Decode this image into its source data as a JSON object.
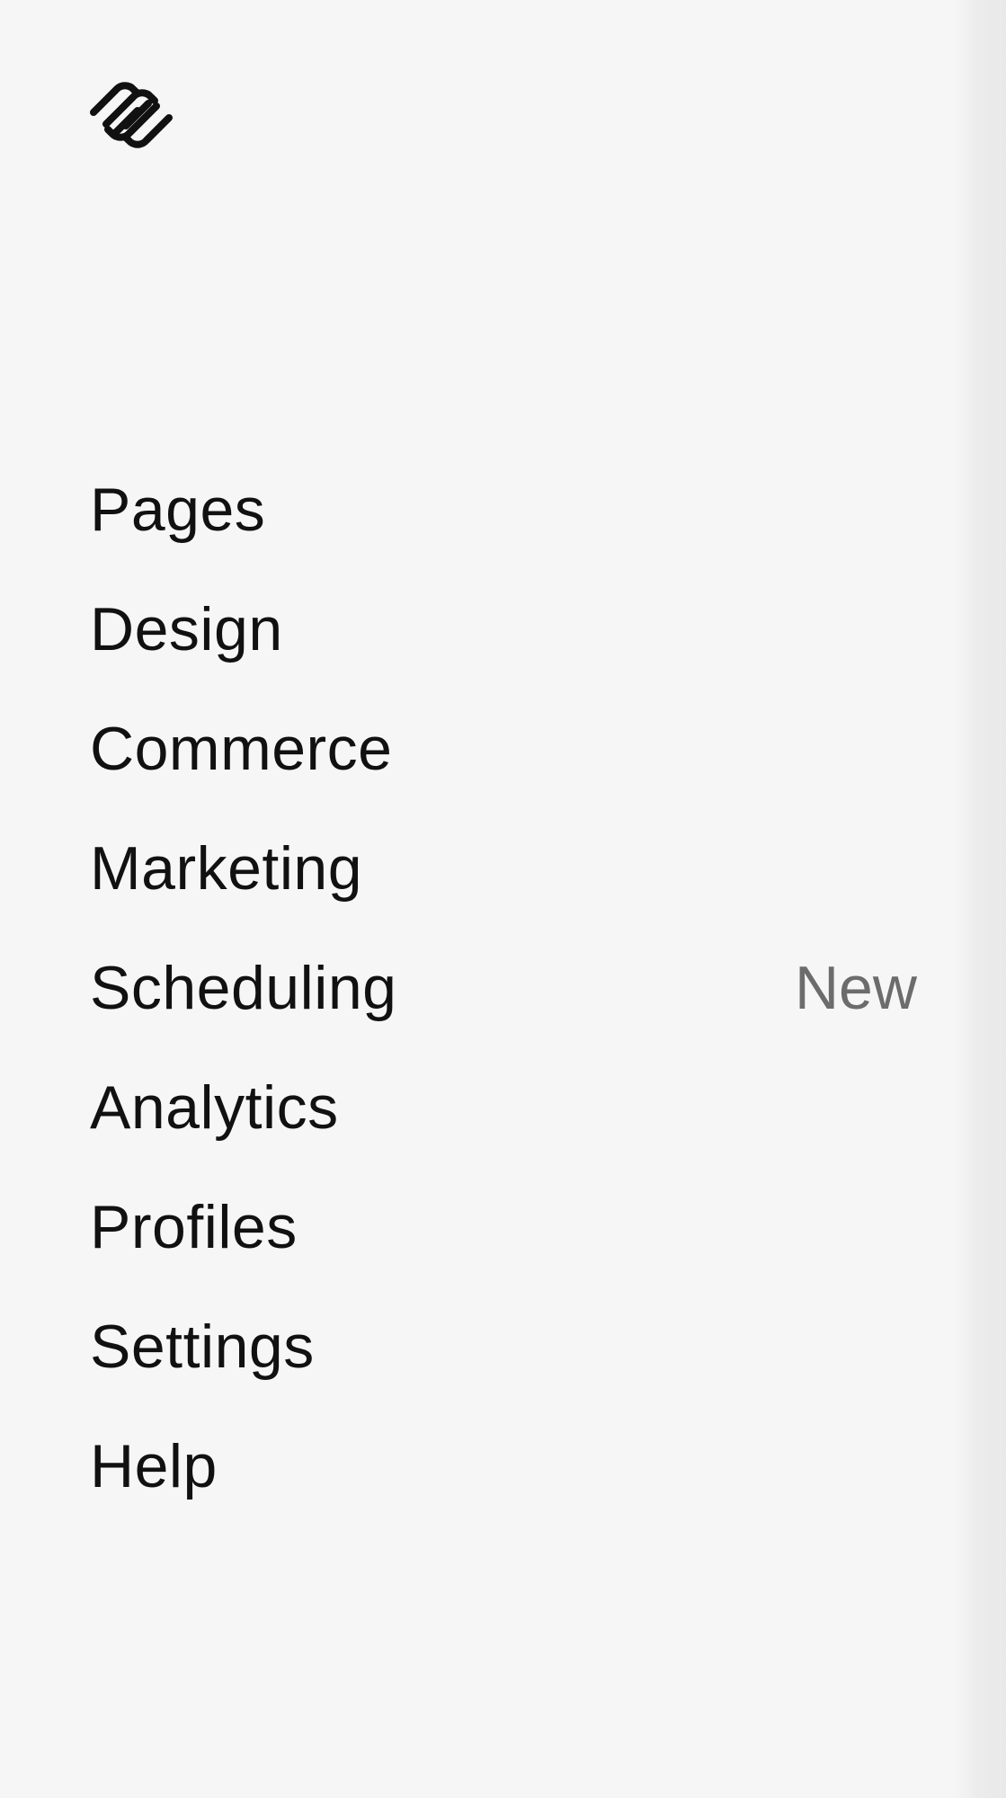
{
  "brand": {
    "logo_icon": "squarespace-logo-icon"
  },
  "nav": {
    "items": [
      {
        "label": "Pages"
      },
      {
        "label": "Design"
      },
      {
        "label": "Commerce"
      },
      {
        "label": "Marketing"
      },
      {
        "label": "Scheduling",
        "badge": "New"
      },
      {
        "label": "Analytics"
      },
      {
        "label": "Profiles"
      },
      {
        "label": "Settings"
      },
      {
        "label": "Help"
      }
    ]
  },
  "colors": {
    "background": "#f6f6f6",
    "text": "#111111",
    "badge_text": "#6c6c6c"
  }
}
